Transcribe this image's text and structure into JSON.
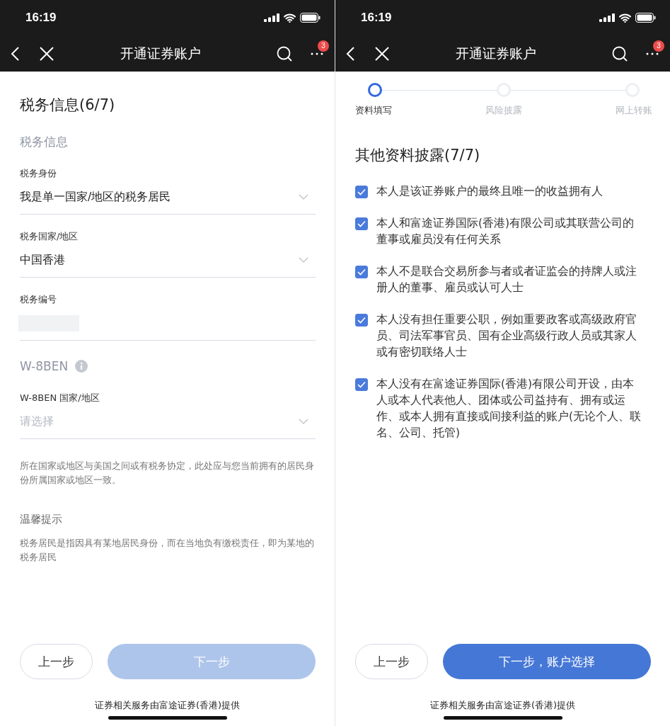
{
  "screens": [
    {
      "kind": "tax_form",
      "status_bar": {
        "time": "16:19"
      },
      "nav": {
        "title": "开通证券账户",
        "badge": "3"
      },
      "title": "税务信息(6/7)",
      "sections": [
        {
          "heading": "税务信息",
          "info": false,
          "fields": [
            {
              "kind": "select",
              "label": "税务身份",
              "value": "我是单一国家/地区的税务居民"
            },
            {
              "kind": "select",
              "label": "税务国家/地区",
              "value": "中国香港"
            },
            {
              "kind": "masked",
              "label": "税务编号"
            }
          ]
        },
        {
          "heading": "W-8BEN",
          "info": true,
          "fields": [
            {
              "kind": "select",
              "label": "W-8BEN 国家/地区",
              "placeholder": "请选择"
            }
          ]
        }
      ],
      "note": "所在国家或地区与美国之间或有税务协定，此处应与您当前拥有的居民身份所属国家或地区一致。",
      "tip": {
        "heading": "温馨提示",
        "text": "税务居民是指因具有某地居民身份，而在当地负有缴税责任，即为某地的税务居民"
      },
      "buttons": {
        "back": "上一步",
        "next": "下一步",
        "next_disabled": true
      },
      "footer": "证券相关服务由富途证券(香港)提供"
    },
    {
      "kind": "disclosure",
      "status_bar": {
        "time": "16:19"
      },
      "nav": {
        "title": "开通证券账户",
        "badge": "3"
      },
      "steps": [
        {
          "label": "资料填写",
          "selected": true
        },
        {
          "label": "风险披露",
          "selected": false
        },
        {
          "label": "网上转账",
          "selected": false
        }
      ],
      "title": "其他资料披露(7/7)",
      "checks": [
        {
          "text": "本人是该证券账户的最终且唯一的收益拥有人",
          "checked": true
        },
        {
          "text": "本人和富途证券国际(香港)有限公司或其联营公司的董事或雇员没有任何关系",
          "checked": true
        },
        {
          "text": "本人不是联合交易所参与者或者证监会的持牌人或注册人的董事、雇员或认可人士",
          "checked": true
        },
        {
          "text": "本人没有担任重要公职，例如重要政客或高级政府官员、司法军事官员、国有企业高级行政人员或其家人或有密切联络人士",
          "checked": true
        },
        {
          "text": "本人没有在富途证券国际(香港)有限公司开设，由本人或本人代表他人、团体或公司益持有、拥有或运作、或本人拥有直接或间接利益的账户(无论个人、联名、公司、托管)",
          "checked": true
        }
      ],
      "buttons": {
        "back": "上一步",
        "next": "下一步，账户选择",
        "next_disabled": false
      },
      "footer": "证券相关服务由富途证券(香港)提供"
    }
  ]
}
